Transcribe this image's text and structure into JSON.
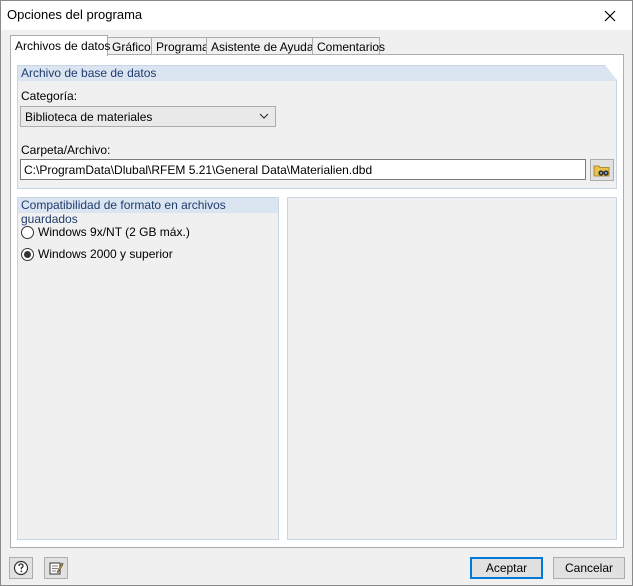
{
  "window": {
    "title": "Opciones del programa"
  },
  "tabs": [
    {
      "label": "Archivos de datos",
      "active": true
    },
    {
      "label": "Gráfico",
      "active": false
    },
    {
      "label": "Programa",
      "active": false
    },
    {
      "label": "Asistente de Ayuda",
      "active": false
    },
    {
      "label": "Comentarios",
      "active": false
    }
  ],
  "database_group": {
    "header": "Archivo de base de datos",
    "category_label": "Categoría:",
    "category_value": "Biblioteca de materiales",
    "folder_label": "Carpeta/Archivo:",
    "folder_value": "C:\\ProgramData\\Dlubal\\RFEM 5.21\\General Data\\Materialien.dbd"
  },
  "format_group": {
    "header": "Compatibilidad de formato en archivos guardados",
    "options": [
      {
        "label": "Windows 9x/NT (2 GB máx.)",
        "checked": false
      },
      {
        "label": "Windows 2000 y superior",
        "checked": true
      }
    ]
  },
  "footer": {
    "accept_label": "Aceptar",
    "cancel_label": "Cancelar"
  },
  "icons": {
    "close": "close-icon",
    "dropdown": "chevron-down-icon",
    "browse": "folder-binoculars-icon",
    "help": "help-icon",
    "edit": "edit-notepad-icon"
  },
  "colors": {
    "group_header_bg": "#dbe5f1",
    "group_header_text": "#1f3c6e",
    "default_button_border": "#0078d7"
  }
}
